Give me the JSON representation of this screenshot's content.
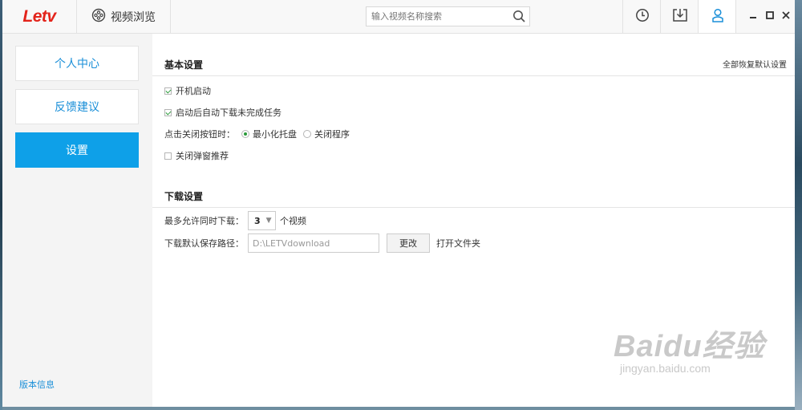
{
  "app": {
    "logo": "Letv",
    "browse_tab": "视频浏览"
  },
  "search": {
    "placeholder": "输入视频名称搜索",
    "value": ""
  },
  "toolbar": {
    "history_icon": "clock-icon",
    "download_icon": "download-icon",
    "user_icon": "user-icon"
  },
  "sidebar": {
    "items": [
      {
        "label": "个人中心",
        "active": false
      },
      {
        "label": "反馈建议",
        "active": false
      },
      {
        "label": "设置",
        "active": true
      }
    ],
    "version_link": "版本信息"
  },
  "basic": {
    "title": "基本设置",
    "restore": "全部恢复默认设置",
    "autostart": {
      "label": "开机启动",
      "checked": true
    },
    "autodownload": {
      "label": "启动后自动下载未完成任务",
      "checked": true
    },
    "close_behavior": {
      "label": "点击关闭按钮时：",
      "options": [
        {
          "label": "最小化托盘",
          "selected": true
        },
        {
          "label": "关闭程序",
          "selected": false
        }
      ]
    },
    "popup": {
      "label": "关闭弹窗推荐",
      "checked": false
    }
  },
  "download": {
    "title": "下载设置",
    "max_label": "最多允许同时下载：",
    "max_value": "3",
    "max_unit": "个视频",
    "path_label": "下载默认保存路径：",
    "path_value": "D:\\LETVdownload",
    "change_button": "更改",
    "open_folder": "打开文件夹"
  },
  "watermark": {
    "main": "Baidu经验",
    "sub": "jingyan.baidu.com"
  },
  "colors": {
    "accent": "#0ea0e8",
    "logo": "#e3241b",
    "link": "#1a8fd8"
  }
}
